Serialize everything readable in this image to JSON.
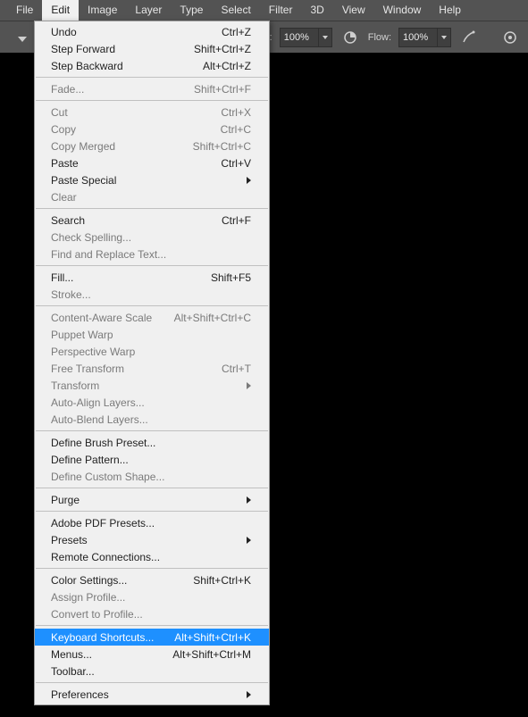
{
  "menubar": [
    "File",
    "Edit",
    "Image",
    "Layer",
    "Type",
    "Select",
    "Filter",
    "3D",
    "View",
    "Window",
    "Help"
  ],
  "menubar_active_index": 1,
  "options": {
    "opacity_label": "acity:",
    "opacity_value": "100%",
    "flow_label": "Flow:",
    "flow_value": "100%"
  },
  "edit_menu": [
    {
      "label": "Undo",
      "shortcut": "Ctrl+Z",
      "enabled": true
    },
    {
      "label": "Step Forward",
      "shortcut": "Shift+Ctrl+Z",
      "enabled": true
    },
    {
      "label": "Step Backward",
      "shortcut": "Alt+Ctrl+Z",
      "enabled": true
    },
    {
      "sep": true
    },
    {
      "label": "Fade...",
      "shortcut": "Shift+Ctrl+F",
      "enabled": false
    },
    {
      "sep": true
    },
    {
      "label": "Cut",
      "shortcut": "Ctrl+X",
      "enabled": false
    },
    {
      "label": "Copy",
      "shortcut": "Ctrl+C",
      "enabled": false
    },
    {
      "label": "Copy Merged",
      "shortcut": "Shift+Ctrl+C",
      "enabled": false
    },
    {
      "label": "Paste",
      "shortcut": "Ctrl+V",
      "enabled": true
    },
    {
      "label": "Paste Special",
      "submenu": true,
      "enabled": true
    },
    {
      "label": "Clear",
      "enabled": false
    },
    {
      "sep": true
    },
    {
      "label": "Search",
      "shortcut": "Ctrl+F",
      "enabled": true
    },
    {
      "label": "Check Spelling...",
      "enabled": false
    },
    {
      "label": "Find and Replace Text...",
      "enabled": false
    },
    {
      "sep": true
    },
    {
      "label": "Fill...",
      "shortcut": "Shift+F5",
      "enabled": true
    },
    {
      "label": "Stroke...",
      "enabled": false
    },
    {
      "sep": true
    },
    {
      "label": "Content-Aware Scale",
      "shortcut": "Alt+Shift+Ctrl+C",
      "enabled": false
    },
    {
      "label": "Puppet Warp",
      "enabled": false
    },
    {
      "label": "Perspective Warp",
      "enabled": false
    },
    {
      "label": "Free Transform",
      "shortcut": "Ctrl+T",
      "enabled": false
    },
    {
      "label": "Transform",
      "submenu": true,
      "enabled": false
    },
    {
      "label": "Auto-Align Layers...",
      "enabled": false
    },
    {
      "label": "Auto-Blend Layers...",
      "enabled": false
    },
    {
      "sep": true
    },
    {
      "label": "Define Brush Preset...",
      "enabled": true
    },
    {
      "label": "Define Pattern...",
      "enabled": true
    },
    {
      "label": "Define Custom Shape...",
      "enabled": false
    },
    {
      "sep": true
    },
    {
      "label": "Purge",
      "submenu": true,
      "enabled": true
    },
    {
      "sep": true
    },
    {
      "label": "Adobe PDF Presets...",
      "enabled": true
    },
    {
      "label": "Presets",
      "submenu": true,
      "enabled": true
    },
    {
      "label": "Remote Connections...",
      "enabled": true
    },
    {
      "sep": true
    },
    {
      "label": "Color Settings...",
      "shortcut": "Shift+Ctrl+K",
      "enabled": true
    },
    {
      "label": "Assign Profile...",
      "enabled": false
    },
    {
      "label": "Convert to Profile...",
      "enabled": false
    },
    {
      "sep": true
    },
    {
      "label": "Keyboard Shortcuts...",
      "shortcut": "Alt+Shift+Ctrl+K",
      "enabled": true,
      "highlight": true
    },
    {
      "label": "Menus...",
      "shortcut": "Alt+Shift+Ctrl+M",
      "enabled": true
    },
    {
      "label": "Toolbar...",
      "enabled": true
    },
    {
      "sep": true
    },
    {
      "label": "Preferences",
      "submenu": true,
      "enabled": true
    }
  ]
}
